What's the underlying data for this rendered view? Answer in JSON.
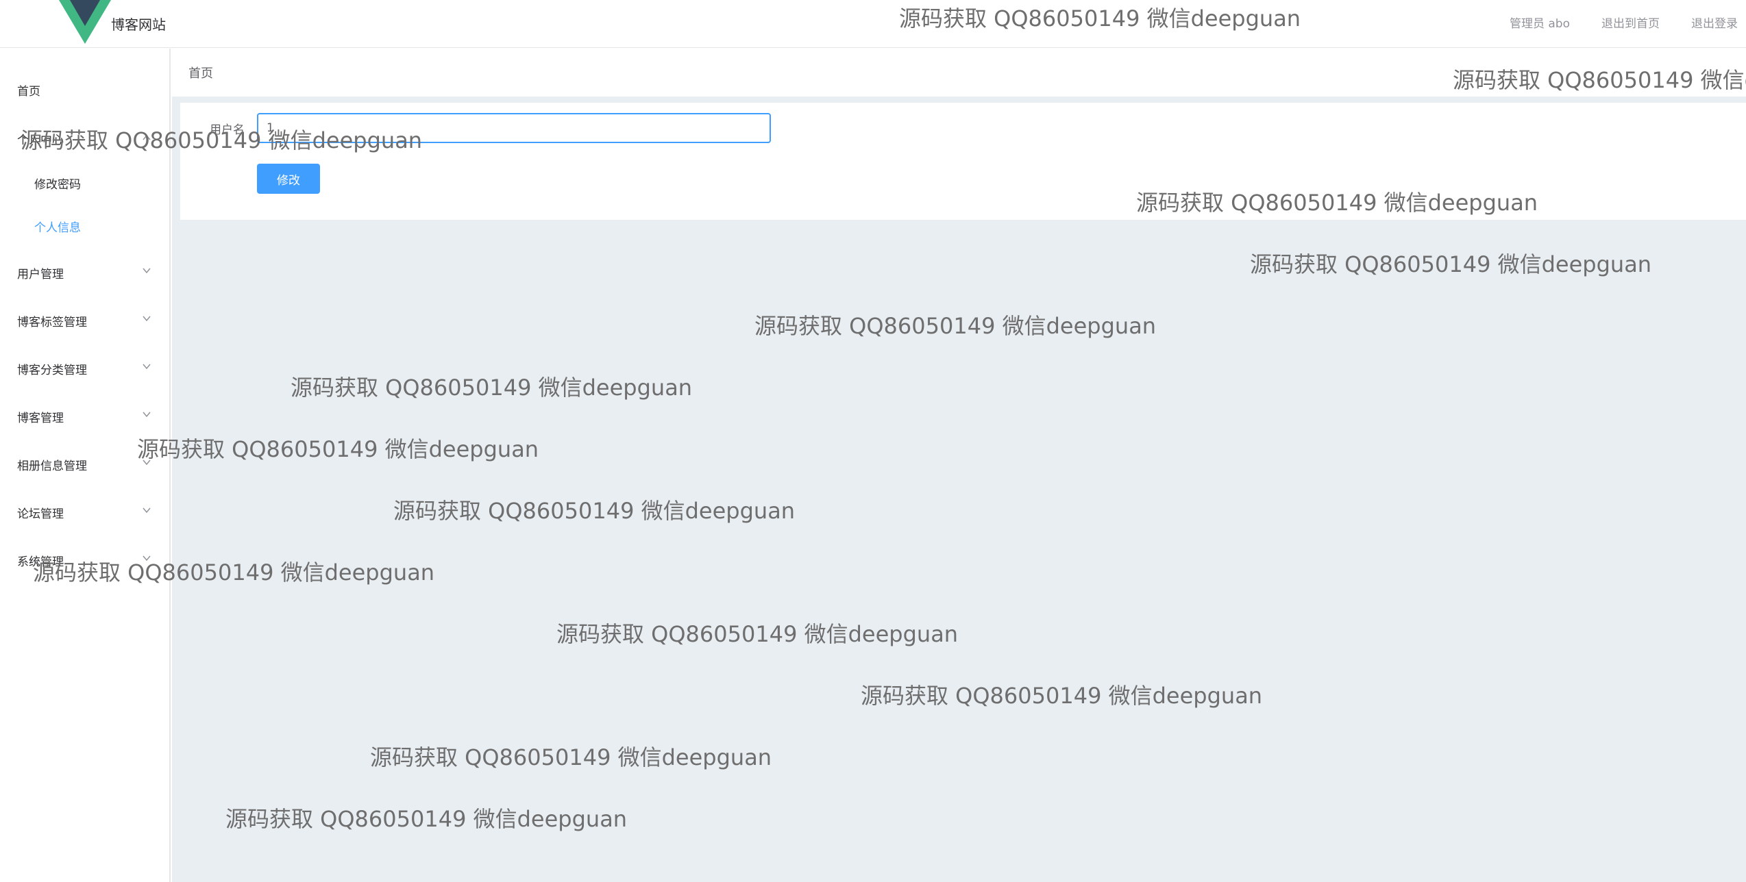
{
  "header": {
    "site_name": "博客网站",
    "user_label": "管理员 abo",
    "home_link": "退出到首页",
    "logout_link": "退出登录",
    "logo_colors": {
      "outer": "#41b883",
      "inner": "#35495e"
    }
  },
  "sidebar": {
    "items": [
      {
        "label": "首页"
      },
      {
        "label": "个人中心"
      },
      {
        "label": "修改密码"
      },
      {
        "label": "个人信息"
      },
      {
        "label": "用户管理"
      },
      {
        "label": "博客标签管理"
      },
      {
        "label": "博客分类管理"
      },
      {
        "label": "博客管理"
      },
      {
        "label": "相册信息管理"
      },
      {
        "label": "论坛管理"
      },
      {
        "label": "系统管理"
      }
    ],
    "active_color": "#409eff"
  },
  "breadcrumb": {
    "label": "首页"
  },
  "form": {
    "username_label": "用户名",
    "username_value": "1",
    "submit_label": "修改"
  },
  "watermark": {
    "text": "源码获取 QQ86050149 微信deepguan"
  }
}
